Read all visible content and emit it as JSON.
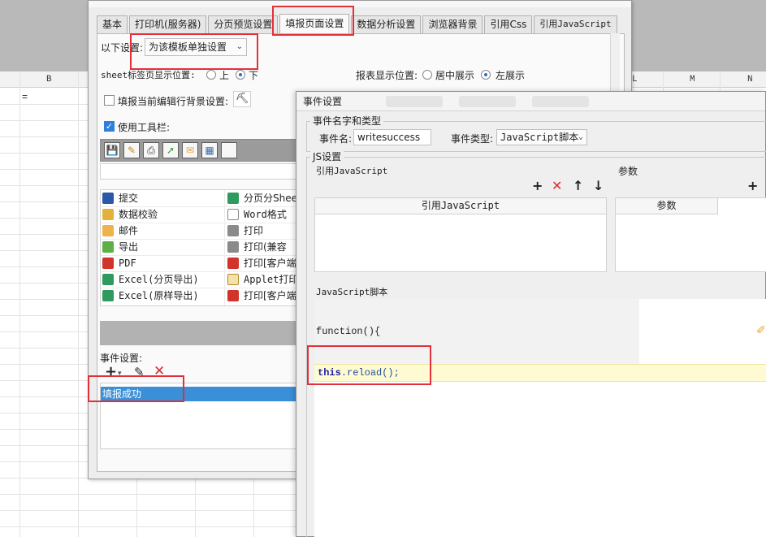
{
  "spreadsheet": {
    "col_b": "B",
    "col_l": "L",
    "col_m": "M",
    "col_n": "N",
    "cell_b1": "="
  },
  "report_settings": {
    "tabs": [
      {
        "label": "基本"
      },
      {
        "label": "打印机(服务器)"
      },
      {
        "label": "分页预览设置"
      },
      {
        "label": "填报页面设置",
        "active": true
      },
      {
        "label": "数据分析设置"
      },
      {
        "label": "浏览器背景"
      },
      {
        "label": "引用Css"
      },
      {
        "label": "引用JavaScript"
      }
    ],
    "scope_label": "以下设置:",
    "scope_value": "为该模板单独设置",
    "sheet_tab_position_label": "sheet标签页显示位置:",
    "sheet_tab_options": [
      "上",
      "下"
    ],
    "sheet_tab_selected": "下",
    "report_position_label": "报表显示位置:",
    "report_position_options": [
      "居中展示",
      "左展示"
    ],
    "report_position_selected": "左展示",
    "fill_row_bg_label": "填报当前编辑行背景设置:",
    "fill_row_bg_checked": false,
    "use_toolbar_label": "使用工具栏:",
    "use_toolbar_checked": true,
    "toolbar_icons": [
      "save-icon",
      "validate-icon",
      "print-icon",
      "export-icon",
      "email-icon",
      "structure-icon",
      "blank-icon"
    ],
    "buttons_left": [
      {
        "label": "提交",
        "icon": "save-icon"
      },
      {
        "label": "数据校验",
        "icon": "validate-icon"
      },
      {
        "label": "邮件",
        "icon": "email-icon"
      },
      {
        "label": "导出",
        "icon": "export-icon"
      },
      {
        "label": "PDF",
        "icon": "pdf-icon"
      },
      {
        "label": "Excel(分页导出)",
        "icon": "excel-icon"
      },
      {
        "label": "Excel(原样导出)",
        "icon": "excel-icon"
      }
    ],
    "buttons_right": [
      {
        "label": "分页分Sheet",
        "icon": "excel-icon"
      },
      {
        "label": "Word格式",
        "icon": "word-icon"
      },
      {
        "label": "打印",
        "icon": "print-icon"
      },
      {
        "label": "打印(兼容",
        "icon": "print-icon"
      },
      {
        "label": "打印[客户端",
        "icon": "pdf-icon"
      },
      {
        "label": "Applet打印",
        "icon": "applet-icon"
      },
      {
        "label": "打印[客户端",
        "icon": "pdf-icon"
      }
    ],
    "event_settings_label": "事件设置:",
    "events": [
      "填报成功"
    ]
  },
  "event_dialog": {
    "title": "事件设置",
    "name_type_group": "事件名字和类型",
    "event_name_label": "事件名:",
    "event_name_value": "writesuccess",
    "event_type_label": "事件类型:",
    "event_type_value": "JavaScript脚本",
    "js_group": "JS设置",
    "ref_js_label": "引用JavaScript",
    "params_label": "参数",
    "ref_js_column": "引用JavaScript",
    "params_column": "参数",
    "script_label": "JavaScript脚本",
    "code_head": "function(){",
    "code_keyword": "this",
    "code_rest": ".reload();"
  },
  "colors": {
    "highlight_red": "#e2303a",
    "selected_blue": "#3b8fd8",
    "code_highlight": "#fefbd2"
  }
}
